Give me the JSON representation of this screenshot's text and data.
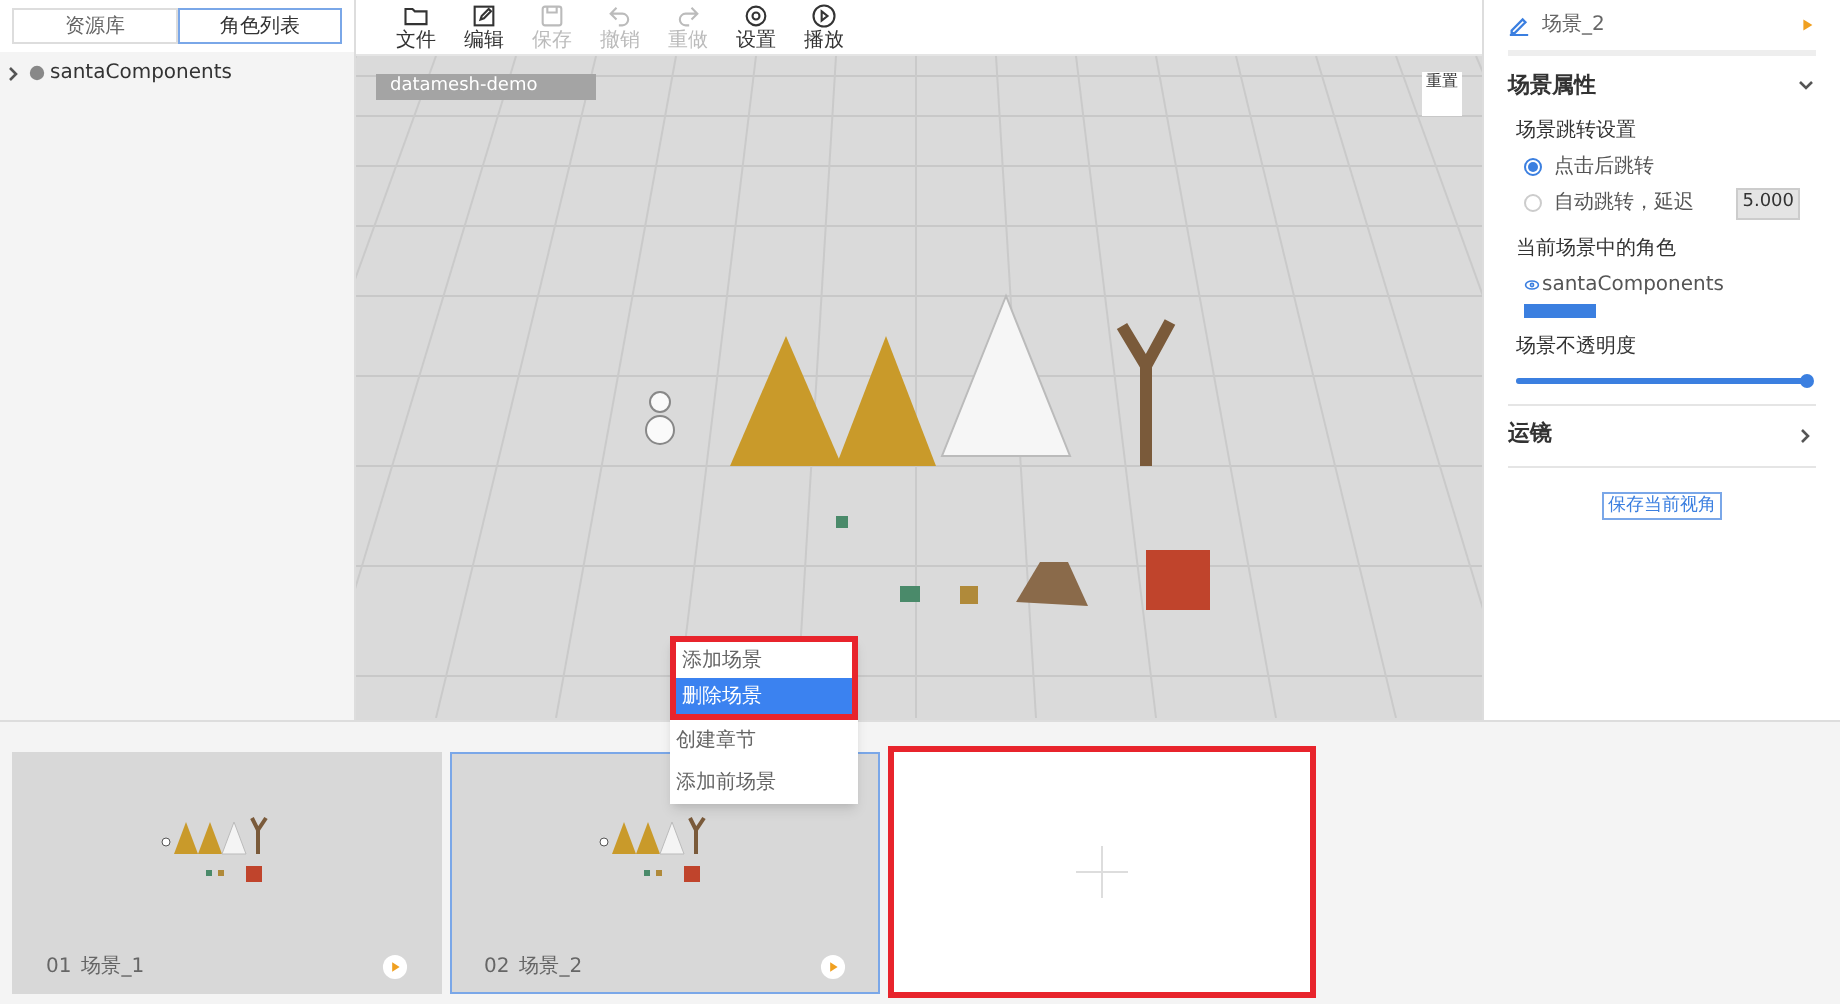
{
  "left_panel": {
    "tabs": [
      {
        "label": "资源库",
        "selected": false
      },
      {
        "label": "角色列表",
        "selected": true
      }
    ],
    "tree": [
      {
        "label": "santaComponents",
        "expanded": false
      }
    ]
  },
  "toolbar": [
    {
      "label": "文件",
      "kind": "folder",
      "disabled": false
    },
    {
      "label": "编辑",
      "kind": "edit",
      "disabled": false
    },
    {
      "label": "保存",
      "kind": "save",
      "disabled": true
    },
    {
      "label": "撤销",
      "kind": "undo",
      "disabled": true
    },
    {
      "label": "重做",
      "kind": "redo",
      "disabled": true
    },
    {
      "label": "设置",
      "kind": "settings",
      "disabled": false
    },
    {
      "label": "播放",
      "kind": "play",
      "disabled": false
    }
  ],
  "viewport": {
    "project_label": "datamesh-demo",
    "reset_button": "重置"
  },
  "context_menu": {
    "items": [
      {
        "label": "添加场景",
        "selected": false,
        "highlighted": true
      },
      {
        "label": "删除场景",
        "selected": true,
        "highlighted": true
      },
      {
        "label": "创建章节",
        "selected": false,
        "highlighted": false
      },
      {
        "label": "添加前场景",
        "selected": false,
        "highlighted": false
      }
    ]
  },
  "right_panel": {
    "scene_name": "场景_2",
    "sections": [
      {
        "title": "场景属性",
        "expanded": true
      },
      {
        "title": "运镜",
        "expanded": false
      }
    ],
    "jump_settings": {
      "title": "场景跳转设置",
      "options": [
        {
          "label": "点击后跳转",
          "selected": true
        },
        {
          "label": "自动跳转，延迟",
          "selected": false
        }
      ],
      "delay": "5.000"
    },
    "roles": {
      "title": "当前场景中的角色",
      "items": [
        "santaComponents"
      ]
    },
    "opacity": {
      "title": "场景不透明度",
      "level": 1.0
    },
    "save_view_button": "保存当前视角"
  },
  "scenes": [
    {
      "number": "01",
      "name": "场景_1",
      "selected": false
    },
    {
      "number": "02",
      "name": "场景_2",
      "selected": true
    }
  ],
  "add_scene_card": {
    "highlighted": true
  }
}
